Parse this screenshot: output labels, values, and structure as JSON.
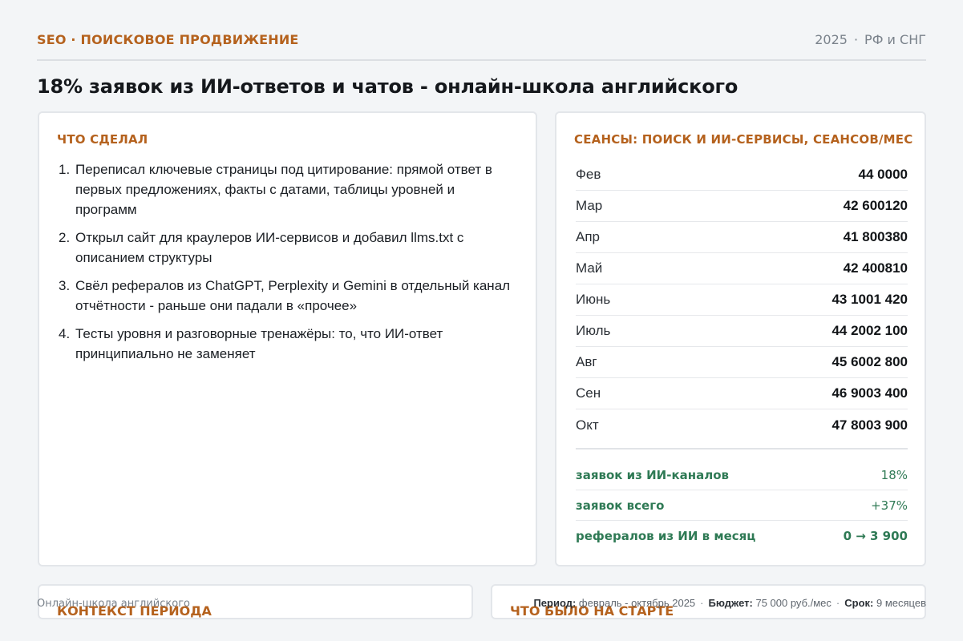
{
  "header": {
    "kicker": "SEO · ПОИСКОВОЕ ПРОДВИЖЕНИЕ",
    "year": "2025",
    "region": "РФ и СНГ"
  },
  "title": "18% заявок из ИИ-ответов и чатов - онлайн-школа английского",
  "left_card": {
    "title": "ЧТО СДЕЛАЛ",
    "steps": [
      {
        "num": "1.",
        "text": "Переписал ключевые страницы под цитирование: прямой ответ в первых предложениях, факты с датами, таблицы уровней и программ"
      },
      {
        "num": "2.",
        "text": "Открыл сайт для краулеров ИИ-сервисов и добавил llms.txt с описанием структуры"
      },
      {
        "num": "3.",
        "text": "Свёл рефералов из ChatGPT, Perplexity и Gemini в отдельный канал отчётности - раньше они падали в «прочее»"
      },
      {
        "num": "4.",
        "text": "Тесты уровня и разговорные тренажёры: то, что ИИ-ответ принципиально не заменяет"
      }
    ]
  },
  "right_card": {
    "title": "СЕАНСЫ: ПОИСК И ИИ-СЕРВИСЫ, СЕАНСОВ/МЕС",
    "rows": [
      {
        "month": "Фев",
        "value": "44 0000"
      },
      {
        "month": "Мар",
        "value": "42 600120"
      },
      {
        "month": "Апр",
        "value": "41 800380"
      },
      {
        "month": "Май",
        "value": "42 400810"
      },
      {
        "month": "Июнь",
        "value": "43 1001 420"
      },
      {
        "month": "Июль",
        "value": "44 2002 100"
      },
      {
        "month": "Авг",
        "value": "45 6002 800"
      },
      {
        "month": "Сен",
        "value": "46 9003 400"
      },
      {
        "month": "Окт",
        "value": "47 8003 900"
      }
    ],
    "kpis": [
      {
        "label": "заявок из ИИ-каналов",
        "value": "18%"
      },
      {
        "label": "заявок всего",
        "value": "+37%"
      },
      {
        "label": "рефералов из ИИ в месяц",
        "value": "0 → 3 900"
      }
    ]
  },
  "bottom": {
    "context_title": "КОНТЕКСТ ПЕРИОДА",
    "start_title": "ЧТО БЫЛО НА СТАРТЕ"
  },
  "footer": {
    "client": "Онлайн-школа английского",
    "period_label": "Период:",
    "period_value": "февраль - октябрь 2025",
    "budget_label": "Бюджет:",
    "budget_value": "75 000 руб./мес",
    "term_label": "Срок:",
    "term_value": "9 месяцев"
  }
}
